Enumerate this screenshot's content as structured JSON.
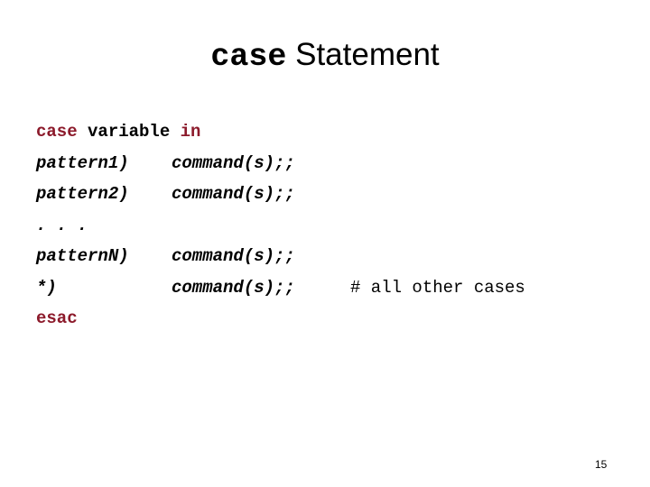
{
  "slide": {
    "title": {
      "keyword": "case",
      "separator": " ",
      "rest": "Statement"
    },
    "page_number": "15",
    "colors": {
      "keyword_red": "#8c1a2b",
      "text_black": "#000000",
      "background": "#ffffff"
    },
    "code": {
      "lines": [
        {
          "id": "line-case-variable-in",
          "keyword1": "case",
          "space1": " ",
          "variable": "variable",
          "space2": " ",
          "keyword2": "in"
        },
        {
          "id": "line-pattern1",
          "pattern": "pattern1)",
          "command": "command(s);;"
        },
        {
          "id": "line-pattern2",
          "pattern": "pattern2)",
          "command": "command(s);;"
        },
        {
          "id": "line-ellipsis",
          "dots": ". . ."
        },
        {
          "id": "line-patternN",
          "pattern": "patternN)",
          "command": "command(s);;"
        },
        {
          "id": "line-default",
          "pattern": "*)",
          "command": "command(s);;",
          "comment": "# all other cases"
        },
        {
          "id": "line-esac",
          "keyword": "esac"
        }
      ]
    }
  }
}
